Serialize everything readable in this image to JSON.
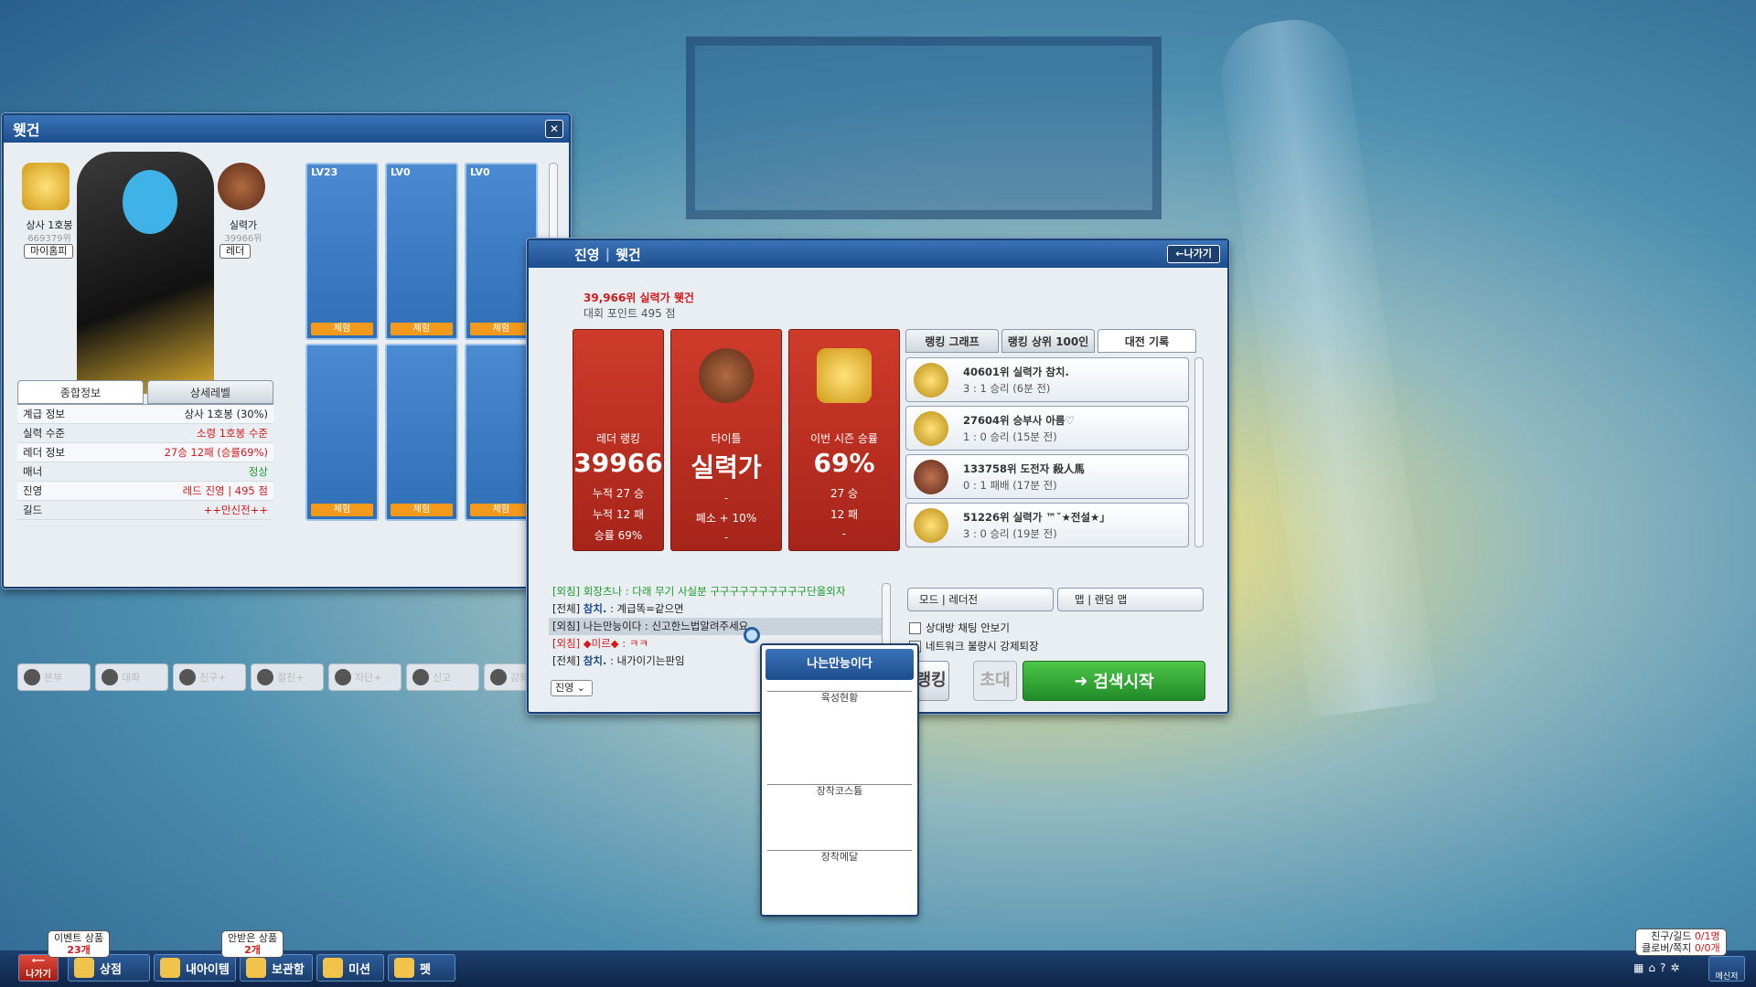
{
  "profile_window": {
    "title": "웻건",
    "rank": {
      "name": "상사 1호봉",
      "points": "669379위",
      "button": "마이홈피"
    },
    "title_badge": {
      "name": "실력가",
      "points": "39966위",
      "button": "레더"
    },
    "tabs": [
      "종합정보",
      "상세레벨"
    ],
    "stats": [
      {
        "label": "계급 정보",
        "value": "상사 1호봉 (30%)",
        "color": "#222222"
      },
      {
        "label": "실력 수준",
        "value": "소령 1호봉 수준",
        "color": "#d21a1a"
      },
      {
        "label": "레더 정보",
        "value": "27승 12패 (승률69%)",
        "color": "#d21a1a"
      },
      {
        "label": "매너",
        "value": "정상",
        "color": "#1b9a2a"
      },
      {
        "label": "진영",
        "value": "레드 진영 | 495 점",
        "color": "#d21a1a"
      },
      {
        "label": "길드",
        "value": "++만신전++",
        "color": "#d21a1a"
      }
    ],
    "slots": [
      {
        "level": "LV23",
        "button": "체험"
      },
      {
        "level": "LV0",
        "button": "체험"
      },
      {
        "level": "LV0",
        "button": "체험"
      },
      {
        "level": "",
        "button": "체험"
      },
      {
        "level": "",
        "button": "체험"
      },
      {
        "level": "",
        "button": "체험"
      }
    ],
    "actions": [
      "본부",
      "대화",
      "친구+",
      "절친+",
      "차단+",
      "신고",
      "강퇴"
    ]
  },
  "ranking_window": {
    "header": {
      "camp": "진영",
      "name": "웻건",
      "exit_button": "←나가기"
    },
    "rank_line": "39,966위 실력가 웻건",
    "points_line": "대회 포인트 495 점",
    "cards": [
      {
        "label": "레더 랭킹",
        "big": "39966",
        "lines": [
          "누적 27 승",
          "누적 12 패",
          "승률 69%"
        ]
      },
      {
        "label": "타이틀",
        "big": "실력가",
        "lines": [
          "-",
          "폐소 + 10%",
          "-"
        ]
      },
      {
        "label": "이번 시즌 승률",
        "big": "69%",
        "lines": [
          "27 승",
          "12 패",
          "-"
        ]
      }
    ],
    "tabs": [
      "랭킹 그래프",
      "랭킹 상위 100인",
      "대전 기록"
    ],
    "records": [
      {
        "line1": "40601위 실력가  참치.",
        "line2": "3 : 1 승리 (6분 전)"
      },
      {
        "line1": "27604위 승부사  아름♡",
        "line2": "1 : 0 승리 (15분 전)"
      },
      {
        "line1": "133758위 도전자  殺人馬",
        "line2": "0 : 1 패배 (17분 전)"
      },
      {
        "line1": "51226위 실력가  ™ˇ★전설★」",
        "line2": "3 : 0 승리 (19분 전)"
      }
    ],
    "chat": [
      {
        "prefix": "[외침]",
        "name": "회장츠나",
        "text": " : 다래 무기 사실분 구구구구구구구구구구단올외자",
        "color": "#1b9a2a"
      },
      {
        "prefix": "[전체]",
        "name": "참치.",
        "text": " : 계급똑=같으면",
        "color": "#222222"
      },
      {
        "prefix": "[외침]",
        "name": "나는만능이다",
        "text": " : 신고한느법알려주세요",
        "color": "#222222"
      },
      {
        "prefix": "[외침]",
        "name": "◆미르◆",
        "text": " : ㅋㅋ",
        "color": "#d21a1a"
      },
      {
        "prefix": "[전체]",
        "name": "참치.",
        "text": " : 내가이기는판임",
        "color": "#222222"
      }
    ],
    "chat_filter": "진영",
    "mode_label": "모드",
    "mode_value": "레더전",
    "map_label": "맵",
    "map_value": "랜덤 맵",
    "option1": "상대방 채팅 안보기",
    "option2": "네트워크 불량시 강제퇴장",
    "ranking_button": "랭킹",
    "invite_button": "초대",
    "search_button": "검색시작"
  },
  "popup": {
    "name": "나는만능이다",
    "sections": [
      "육성현황",
      "장착코스튬",
      "장착메달"
    ]
  },
  "taskbar": {
    "exit": "나가기",
    "items": [
      {
        "key": "F2",
        "label": "상점"
      },
      {
        "key": "F3",
        "label": "내아이템"
      },
      {
        "key": "F4",
        "label": "보관함"
      },
      {
        "key": "F5",
        "label": "미션"
      },
      {
        "key": "F7",
        "label": "펫"
      }
    ],
    "event_badge": {
      "title": "이벤트 상품",
      "count": "23개"
    },
    "unreceived_badge": {
      "title": "안받은 상품",
      "count": "2개"
    },
    "friend_status": {
      "line1_label": "친구/길드",
      "line1_value": "0/1명",
      "line2_label": "클로버/쪽지",
      "line2_value": "0/0개"
    },
    "messenger": "메신저"
  }
}
